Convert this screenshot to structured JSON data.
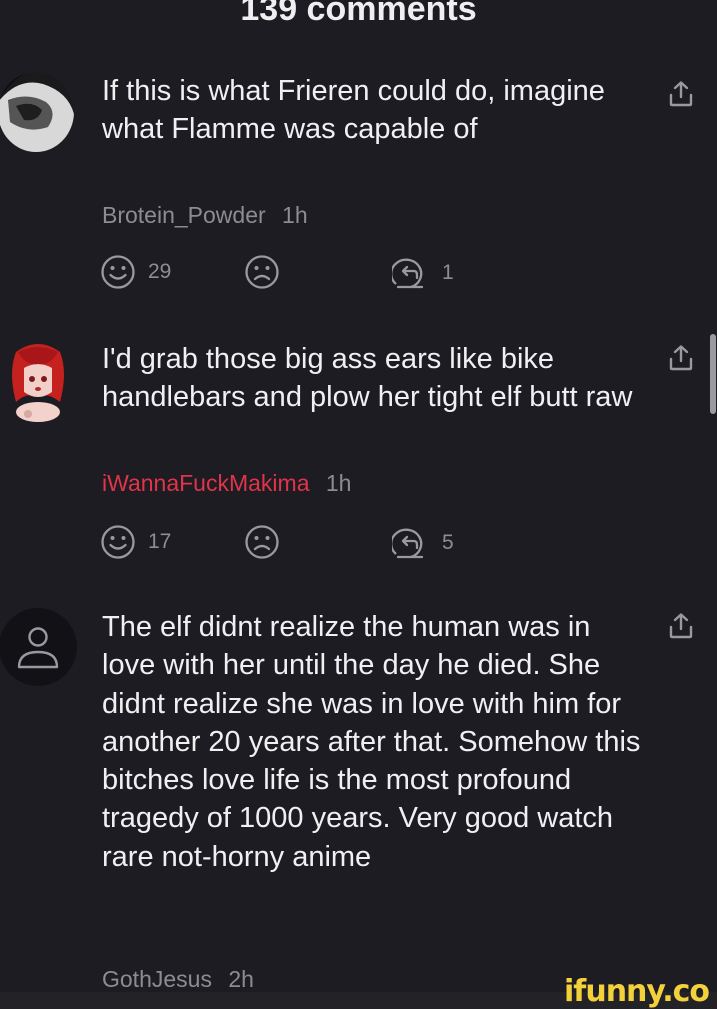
{
  "header": {
    "title": "139 comments"
  },
  "comments": [
    {
      "text": "If this is what Frieren could do, imagine what Flamme was capable of",
      "username": "Brotein_Powder",
      "time": "1h",
      "likes": "29",
      "replies": "1",
      "user_color": "#8d8c92"
    },
    {
      "text": "I'd grab those big ass ears like bike handlebars and plow her tight elf butt raw",
      "username": "iWannaFuckMakima",
      "time": "1h",
      "likes": "17",
      "replies": "5",
      "user_color": "#e0344a"
    },
    {
      "text": "The elf didnt realize the human was in love with her until the day he died. She didnt realize she was in love with him for another 20 years after that. Somehow this bitches love life is the most profound tragedy of 1000 years. Very good watch rare not-horny anime",
      "username": "GothJesus",
      "time": "2h",
      "user_color": "#8d8c92"
    }
  ],
  "icons": {
    "like": "smile-icon",
    "dislike": "frown-icon",
    "reply": "reply-icon",
    "share": "share-icon",
    "default_avatar": "user-icon"
  },
  "watermark": "ifunny.co"
}
